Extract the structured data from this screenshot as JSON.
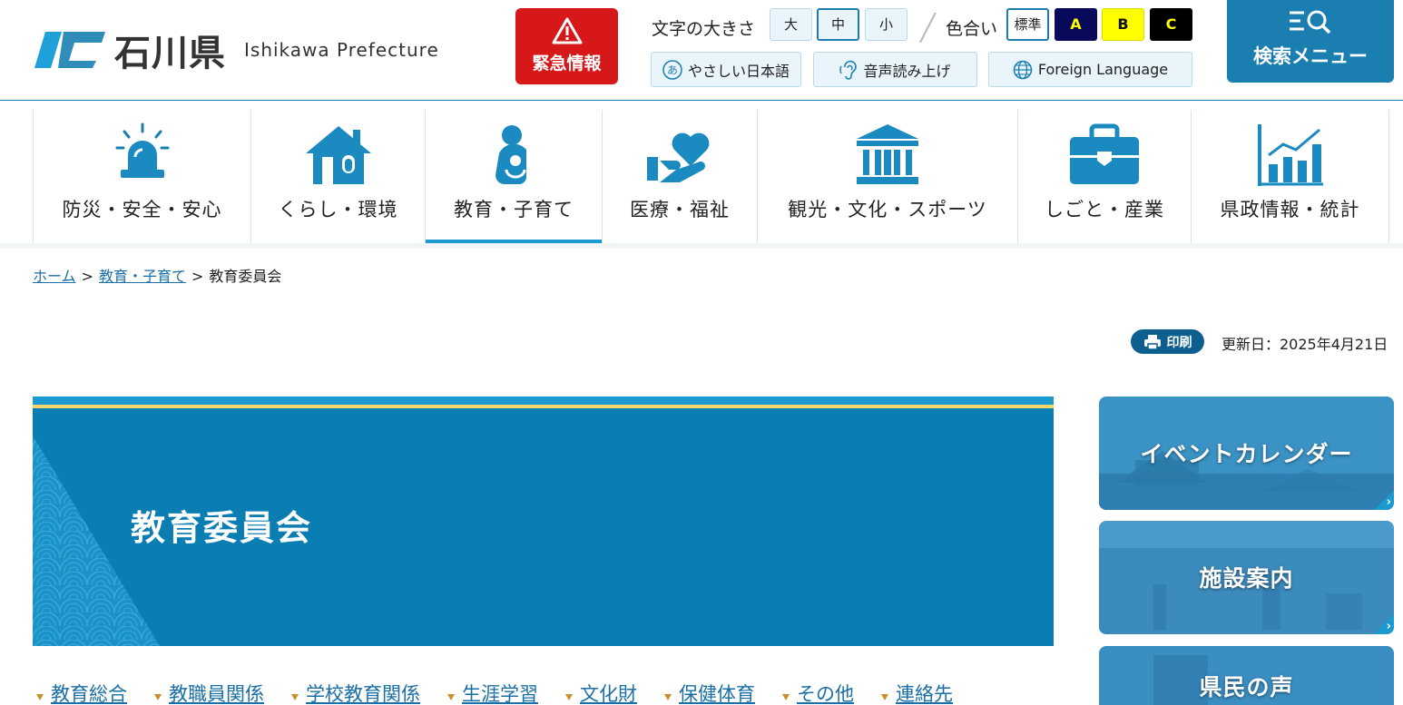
{
  "header": {
    "logo_text": "石川県",
    "logo_en": "Ishikawa Prefecture",
    "emergency_label": "緊急情報",
    "font_size_label": "文字の大きさ",
    "font_sizes": [
      "大",
      "中",
      "小"
    ],
    "color_label": "色合い",
    "color_options": [
      "標準",
      "A",
      "B",
      "C"
    ],
    "easy_japanese": "やさしい日本語",
    "voice_read": "音声読み上げ",
    "foreign_language": "Foreign Language",
    "search_menu": "検索メニュー"
  },
  "nav": {
    "items": [
      {
        "label": "防災・安全・安心",
        "icon": "siren-icon"
      },
      {
        "label": "くらし・環境",
        "icon": "house-icon"
      },
      {
        "label": "教育・子育て",
        "icon": "parent-child-icon",
        "active": true
      },
      {
        "label": "医療・福祉",
        "icon": "hand-heart-icon"
      },
      {
        "label": "観光・文化・スポーツ",
        "icon": "museum-icon"
      },
      {
        "label": "しごと・産業",
        "icon": "briefcase-icon"
      },
      {
        "label": "県政情報・統計",
        "icon": "chart-icon"
      }
    ]
  },
  "breadcrumb": {
    "home": "ホーム",
    "parent": "教育・子育て",
    "current": "教育委員会",
    "separator": ">"
  },
  "page": {
    "print_label": "印刷",
    "updated": "更新日：2025年4月21日",
    "title": "教育委員会"
  },
  "subnav": [
    "教育総合",
    "教職員関係",
    "学校教育関係",
    "生涯学習",
    "文化財",
    "保健体育",
    "その他",
    "連絡先"
  ],
  "side_banners": [
    "イベントカレンダー",
    "施設案内",
    "県民の声"
  ],
  "colors": {
    "primary": "#0a7db3",
    "accent": "#1a9ad0",
    "emergency": "#d71818",
    "gold": "#f0d66a"
  }
}
